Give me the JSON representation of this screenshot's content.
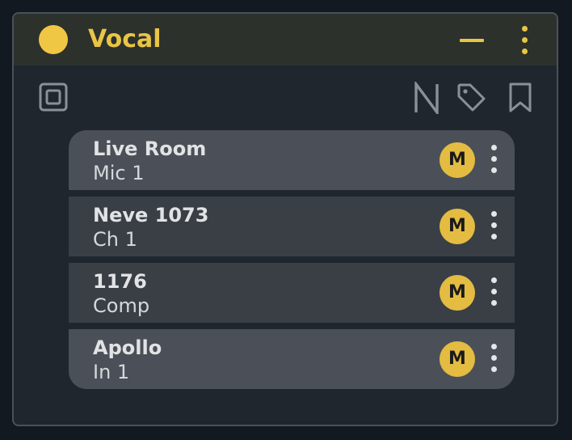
{
  "track": {
    "title": "Vocal",
    "color": "#f0c744",
    "accent_color": "#e9c545"
  },
  "header": {
    "icons": [
      "color-dot",
      "minimize-icon",
      "more-vertical-icon"
    ]
  },
  "toolbar": {
    "icons": [
      "mono-stereo-icon",
      "notes-icon",
      "tag-icon",
      "bookmark-icon"
    ],
    "notes_letter": "N"
  },
  "signal_chain": [
    {
      "name": "Live Room",
      "detail": "Mic 1",
      "badge": "M"
    },
    {
      "name": "Neve 1073",
      "detail": "Ch 1",
      "badge": "M"
    },
    {
      "name": "1176",
      "detail": "Comp",
      "badge": "M"
    },
    {
      "name": "Apollo",
      "detail": "In 1",
      "badge": "M"
    }
  ]
}
